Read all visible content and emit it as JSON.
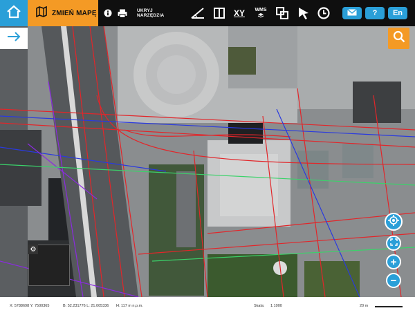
{
  "toolbar": {
    "change_map_label": "ZMIEŃ MAPĘ",
    "hide_tools_label": "UKRYJ NARZĘDZIA",
    "xy_label": "XY",
    "wms_label": "WMS",
    "help_label": "?",
    "lang_label": "En"
  },
  "status": {
    "xy": "X: 5788698  Y: 7500365",
    "bl": "B: 52.231776  L: 21.005336",
    "h": "H: 117 m n.p.m.",
    "scale_label": "Skala:",
    "scale_value": "1:1000",
    "scalebar_label": "20 m"
  },
  "map": {
    "zoom_in_label": "+",
    "zoom_out_label": "−"
  },
  "colors": {
    "accent_blue": "#2a9fd8",
    "accent_orange": "#f49a25",
    "toolbar_bg": "#0f0f0f"
  },
  "icons": [
    "home-icon",
    "map-book-icon",
    "info-icon",
    "print-icon",
    "measure-angle-icon",
    "split-view-icon",
    "wms-layer-icon",
    "select-area-icon",
    "cursor-icon",
    "history-clock-icon",
    "mail-icon",
    "arrow-right-icon",
    "search-icon",
    "locate-icon",
    "fullscreen-icon",
    "gear-icon"
  ]
}
